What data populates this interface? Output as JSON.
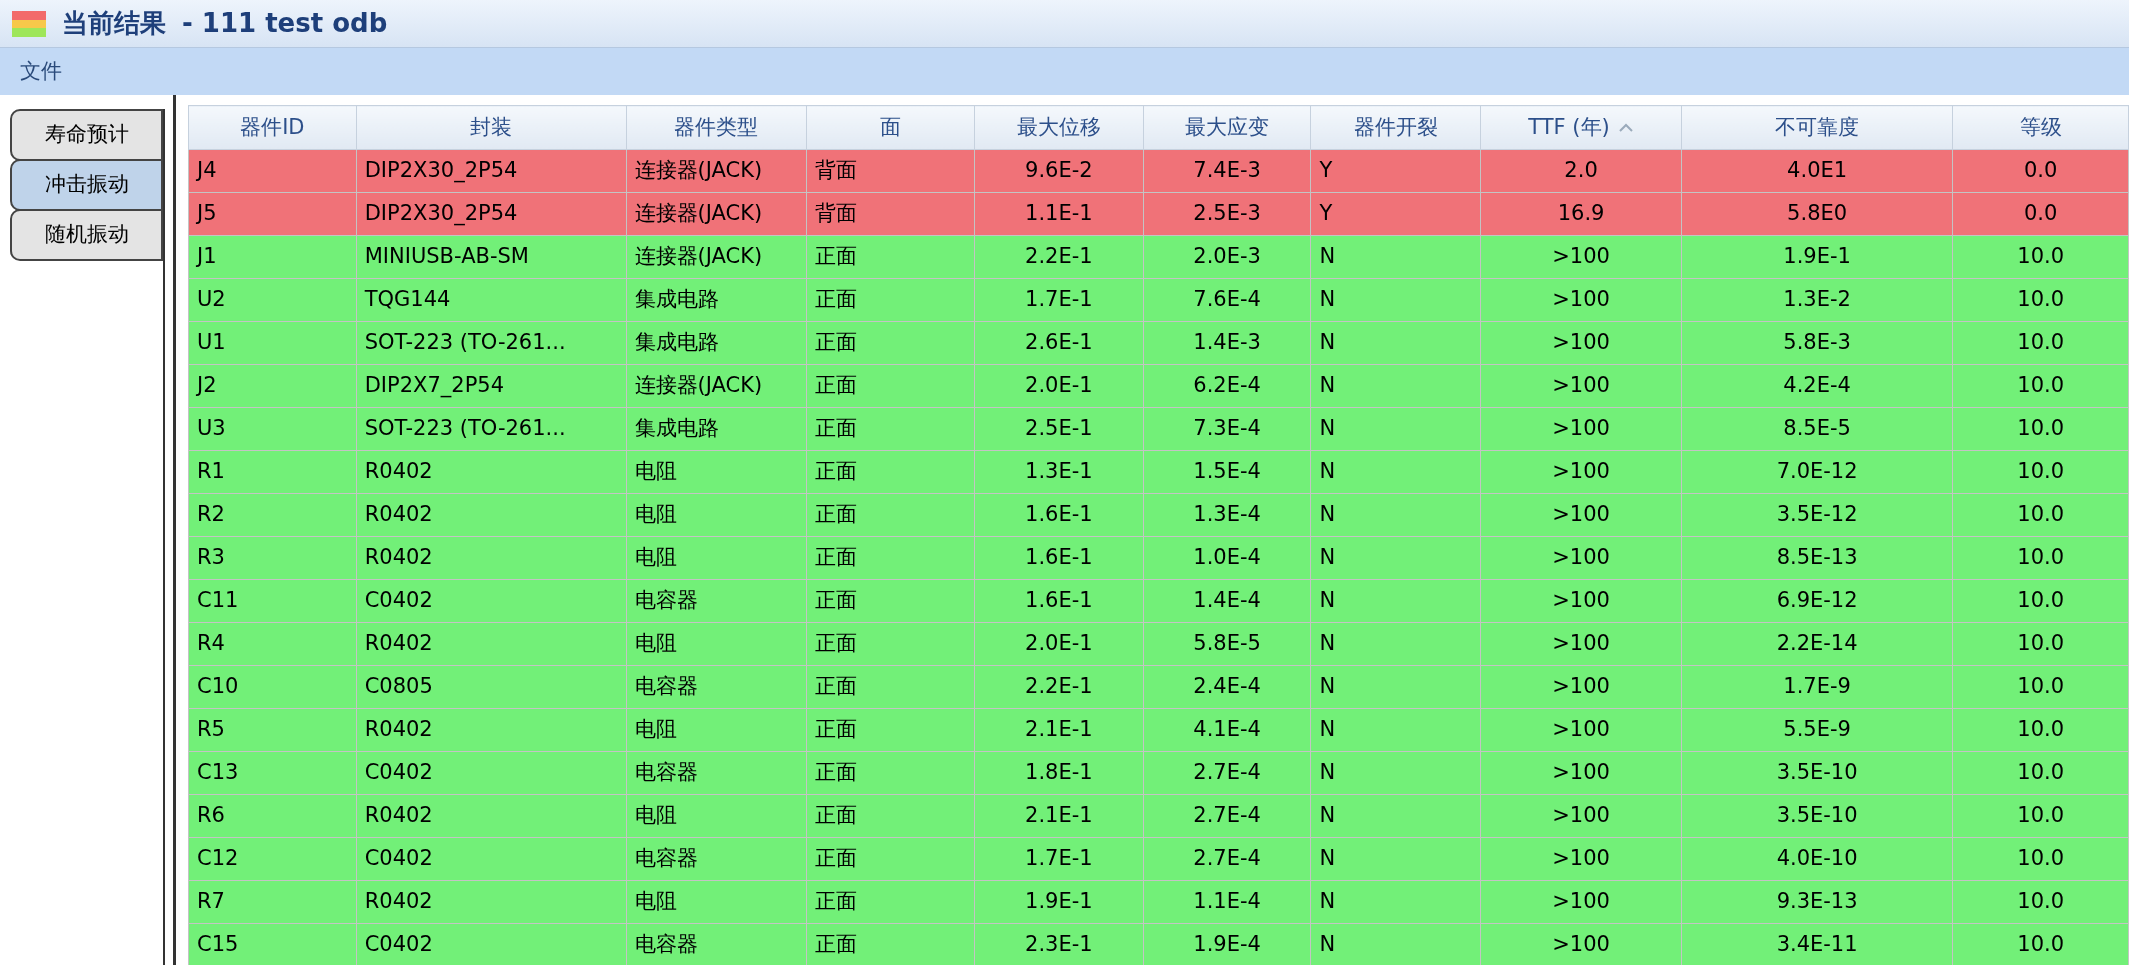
{
  "window": {
    "title": "当前结果",
    "subtitle": "- 111 test odb"
  },
  "menu": [
    "文件"
  ],
  "tabs": [
    {
      "label": "寿命预计",
      "selected": false
    },
    {
      "label": "冲击振动",
      "selected": true
    },
    {
      "label": "随机振动",
      "selected": false
    }
  ],
  "table": {
    "columns": [
      {
        "label": "器件ID",
        "sorted": false
      },
      {
        "label": "封装",
        "sorted": false
      },
      {
        "label": "器件类型",
        "sorted": false
      },
      {
        "label": "面",
        "sorted": false
      },
      {
        "label": "最大位移",
        "sorted": false
      },
      {
        "label": "最大应变",
        "sorted": false
      },
      {
        "label": "器件开裂",
        "sorted": false
      },
      {
        "label": "TTF (年)",
        "sorted": true
      },
      {
        "label": "不可靠度",
        "sorted": false
      },
      {
        "label": "等级",
        "sorted": false
      }
    ],
    "rows": [
      {
        "color": "#f07278",
        "cells": [
          "J4",
          "DIP2X30_2P54",
          "连接器(JACK)",
          "背面",
          "9.6E-2",
          "7.4E-3",
          "Y",
          "2.0",
          "4.0E1",
          "0.0"
        ]
      },
      {
        "color": "#f07278",
        "cells": [
          "J5",
          "DIP2X30_2P54",
          "连接器(JACK)",
          "背面",
          "1.1E-1",
          "2.5E-3",
          "Y",
          "16.9",
          "5.8E0",
          "0.0"
        ]
      },
      {
        "color": "#72f078",
        "cells": [
          "J1",
          "MINIUSB-AB-SM",
          "连接器(JACK)",
          "正面",
          "2.2E-1",
          "2.0E-3",
          "N",
          ">100",
          "1.9E-1",
          "10.0"
        ]
      },
      {
        "color": "#72f078",
        "cells": [
          "U2",
          "TQG144",
          "集成电路",
          "正面",
          "1.7E-1",
          "7.6E-4",
          "N",
          ">100",
          "1.3E-2",
          "10.0"
        ]
      },
      {
        "color": "#72f078",
        "cells": [
          "U1",
          "SOT-223 (TO-261...",
          "集成电路",
          "正面",
          "2.6E-1",
          "1.4E-3",
          "N",
          ">100",
          "5.8E-3",
          "10.0"
        ]
      },
      {
        "color": "#72f078",
        "cells": [
          "J2",
          "DIP2X7_2P54",
          "连接器(JACK)",
          "正面",
          "2.0E-1",
          "6.2E-4",
          "N",
          ">100",
          "4.2E-4",
          "10.0"
        ]
      },
      {
        "color": "#72f078",
        "cells": [
          "U3",
          "SOT-223 (TO-261...",
          "集成电路",
          "正面",
          "2.5E-1",
          "7.3E-4",
          "N",
          ">100",
          "8.5E-5",
          "10.0"
        ]
      },
      {
        "color": "#72f078",
        "cells": [
          "R1",
          "R0402",
          "电阻",
          "正面",
          "1.3E-1",
          "1.5E-4",
          "N",
          ">100",
          "7.0E-12",
          "10.0"
        ]
      },
      {
        "color": "#72f078",
        "cells": [
          "R2",
          "R0402",
          "电阻",
          "正面",
          "1.6E-1",
          "1.3E-4",
          "N",
          ">100",
          "3.5E-12",
          "10.0"
        ]
      },
      {
        "color": "#72f078",
        "cells": [
          "R3",
          "R0402",
          "电阻",
          "正面",
          "1.6E-1",
          "1.0E-4",
          "N",
          ">100",
          "8.5E-13",
          "10.0"
        ]
      },
      {
        "color": "#72f078",
        "cells": [
          "C11",
          "C0402",
          "电容器",
          "正面",
          "1.6E-1",
          "1.4E-4",
          "N",
          ">100",
          "6.9E-12",
          "10.0"
        ]
      },
      {
        "color": "#72f078",
        "cells": [
          "R4",
          "R0402",
          "电阻",
          "正面",
          "2.0E-1",
          "5.8E-5",
          "N",
          ">100",
          "2.2E-14",
          "10.0"
        ]
      },
      {
        "color": "#72f078",
        "cells": [
          "C10",
          "C0805",
          "电容器",
          "正面",
          "2.2E-1",
          "2.4E-4",
          "N",
          ">100",
          "1.7E-9",
          "10.0"
        ]
      },
      {
        "color": "#72f078",
        "cells": [
          "R5",
          "R0402",
          "电阻",
          "正面",
          "2.1E-1",
          "4.1E-4",
          "N",
          ">100",
          "5.5E-9",
          "10.0"
        ]
      },
      {
        "color": "#72f078",
        "cells": [
          "C13",
          "C0402",
          "电容器",
          "正面",
          "1.8E-1",
          "2.7E-4",
          "N",
          ">100",
          "3.5E-10",
          "10.0"
        ]
      },
      {
        "color": "#72f078",
        "cells": [
          "R6",
          "R0402",
          "电阻",
          "正面",
          "2.1E-1",
          "2.7E-4",
          "N",
          ">100",
          "3.5E-10",
          "10.0"
        ]
      },
      {
        "color": "#72f078",
        "cells": [
          "C12",
          "C0402",
          "电容器",
          "正面",
          "1.7E-1",
          "2.7E-4",
          "N",
          ">100",
          "4.0E-10",
          "10.0"
        ]
      },
      {
        "color": "#72f078",
        "cells": [
          "R7",
          "R0402",
          "电阻",
          "正面",
          "1.9E-1",
          "1.1E-4",
          "N",
          ">100",
          "9.3E-13",
          "10.0"
        ]
      },
      {
        "color": "#72f078",
        "cells": [
          "C15",
          "C0402",
          "电容器",
          "正面",
          "2.3E-1",
          "1.9E-4",
          "N",
          ">100",
          "3.4E-11",
          "10.0"
        ]
      }
    ]
  }
}
